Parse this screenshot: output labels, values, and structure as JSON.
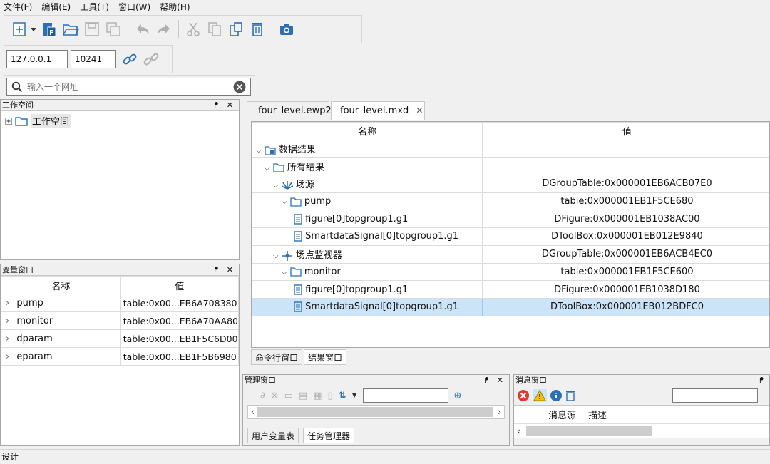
{
  "menu": [
    "文件(F)",
    "编辑(E)",
    "工具(T)",
    "窗口(W)",
    "帮助(H)"
  ],
  "toolbar": {
    "icons": [
      "new-icon",
      "dropdown-arrow-icon",
      "new-file-icon",
      "open-folder-icon",
      "save-icon",
      "save-all-icon",
      "undo-icon",
      "redo-icon",
      "cut-icon",
      "copy-icon",
      "paste-icon",
      "delete-icon",
      "camera-icon"
    ]
  },
  "connection": {
    "ip": "127.0.0.1",
    "port": "10241"
  },
  "search": {
    "placeholder": "输入一个网址"
  },
  "workspace": {
    "title": "工作空间",
    "root": "工作空间"
  },
  "variables": {
    "title": "变量窗口",
    "headers": {
      "name": "名称",
      "value": "值"
    },
    "rows": [
      {
        "name": "pump",
        "value": "table:0x00...EB6A708380"
      },
      {
        "name": "monitor",
        "value": "table:0x00...EB6A70AA80"
      },
      {
        "name": "dparam",
        "value": "table:0x00...EB1F5C6D00"
      },
      {
        "name": "eparam",
        "value": "table:0x00...EB1F5B6980"
      }
    ]
  },
  "editor": {
    "tabs": [
      "four_level.ewp2",
      "four_level.mxd"
    ],
    "headers": {
      "name": "名称",
      "value": "值"
    },
    "rows": [
      {
        "name": "数据结果",
        "value": ""
      },
      {
        "name": "所有结果",
        "value": ""
      },
      {
        "name": "场源",
        "value": "DGroupTable:0x000001EB6ACB07E0"
      },
      {
        "name": "pump",
        "value": "table:0x000001EB1F5CE680"
      },
      {
        "name": "figure[0]topgroup1.g1",
        "value": "DFigure:0x000001EB1038AC00"
      },
      {
        "name": "SmartdataSignal[0]topgroup1.g1",
        "value": "DToolBox:0x000001EB012E9840"
      },
      {
        "name": "场点监视器",
        "value": "DGroupTable:0x000001EB6ACB4EC0"
      },
      {
        "name": "monitor",
        "value": "table:0x000001EB1F5CE600"
      },
      {
        "name": "figure[0]topgroup1.g1",
        "value": "DFigure:0x000001EB1038D180"
      },
      {
        "name": "SmartdataSignal[0]topgroup1.g1",
        "value": "DToolBox:0x000001EB012BDFC0"
      }
    ],
    "bottom_tabs": [
      "命令行窗口",
      "结果窗口"
    ]
  },
  "manager": {
    "title": "管理窗口",
    "bottom_tabs": [
      "用户变量表",
      "任务管理器"
    ]
  },
  "messages": {
    "title": "消息窗口",
    "headers": {
      "source": "消息源",
      "desc": "描述"
    }
  },
  "status": {
    "text": "设计"
  },
  "colors": {
    "accent": "#2d6fb5",
    "selection": "#cce4f7",
    "error": "#e03a2f",
    "warning": "#f5c400"
  }
}
